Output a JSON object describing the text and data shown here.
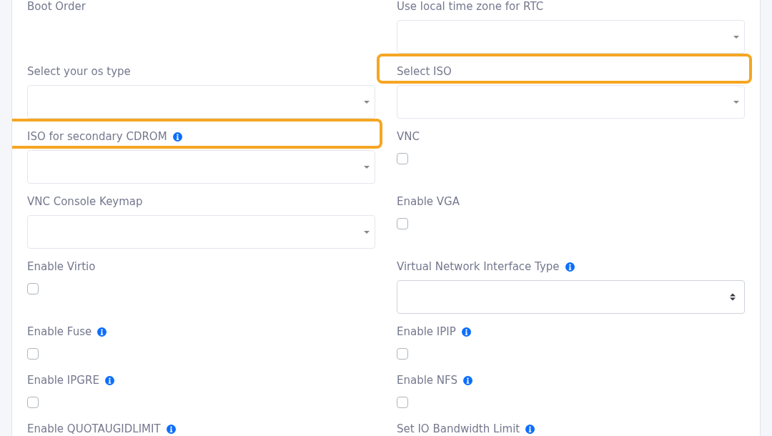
{
  "form": {
    "fields": [
      {
        "label": "Boot Order",
        "kind": "label",
        "info": false,
        "highlighted": false
      },
      {
        "label": "Use local time zone for RTC",
        "kind": "dropdown",
        "info": false,
        "highlighted": false
      },
      {
        "label": "Select your os type",
        "kind": "dropdown",
        "info": false,
        "highlighted": false
      },
      {
        "label": "Select ISO",
        "kind": "dropdown",
        "info": false,
        "highlighted": true
      },
      {
        "label": "ISO for secondary CDROM",
        "kind": "dropdown",
        "info": true,
        "highlighted": true
      },
      {
        "label": "VNC",
        "kind": "checkbox",
        "checked": false,
        "info": false,
        "highlighted": false
      },
      {
        "label": "VNC Console Keymap",
        "kind": "dropdown",
        "info": false,
        "highlighted": false
      },
      {
        "label": "Enable VGA",
        "kind": "checkbox",
        "checked": false,
        "info": false,
        "highlighted": false
      },
      {
        "label": "Enable Virtio",
        "kind": "checkbox",
        "checked": false,
        "info": false,
        "highlighted": false
      },
      {
        "label": "Virtual Network Interface Type",
        "kind": "select",
        "info": true,
        "highlighted": false
      },
      {
        "label": "Enable Fuse",
        "kind": "checkbox",
        "checked": false,
        "info": true,
        "highlighted": false
      },
      {
        "label": "Enable IPIP",
        "kind": "checkbox",
        "checked": false,
        "info": true,
        "highlighted": false
      },
      {
        "label": "Enable IPGRE",
        "kind": "checkbox",
        "checked": false,
        "info": true,
        "highlighted": false
      },
      {
        "label": "Enable NFS",
        "kind": "checkbox",
        "checked": false,
        "info": true,
        "highlighted": false
      },
      {
        "label": "Enable QUOTAUGIDLIMIT",
        "kind": "label",
        "info": true,
        "highlighted": false
      },
      {
        "label": "Set IO Bandwidth Limit",
        "kind": "label",
        "info": true,
        "highlighted": false
      }
    ]
  }
}
